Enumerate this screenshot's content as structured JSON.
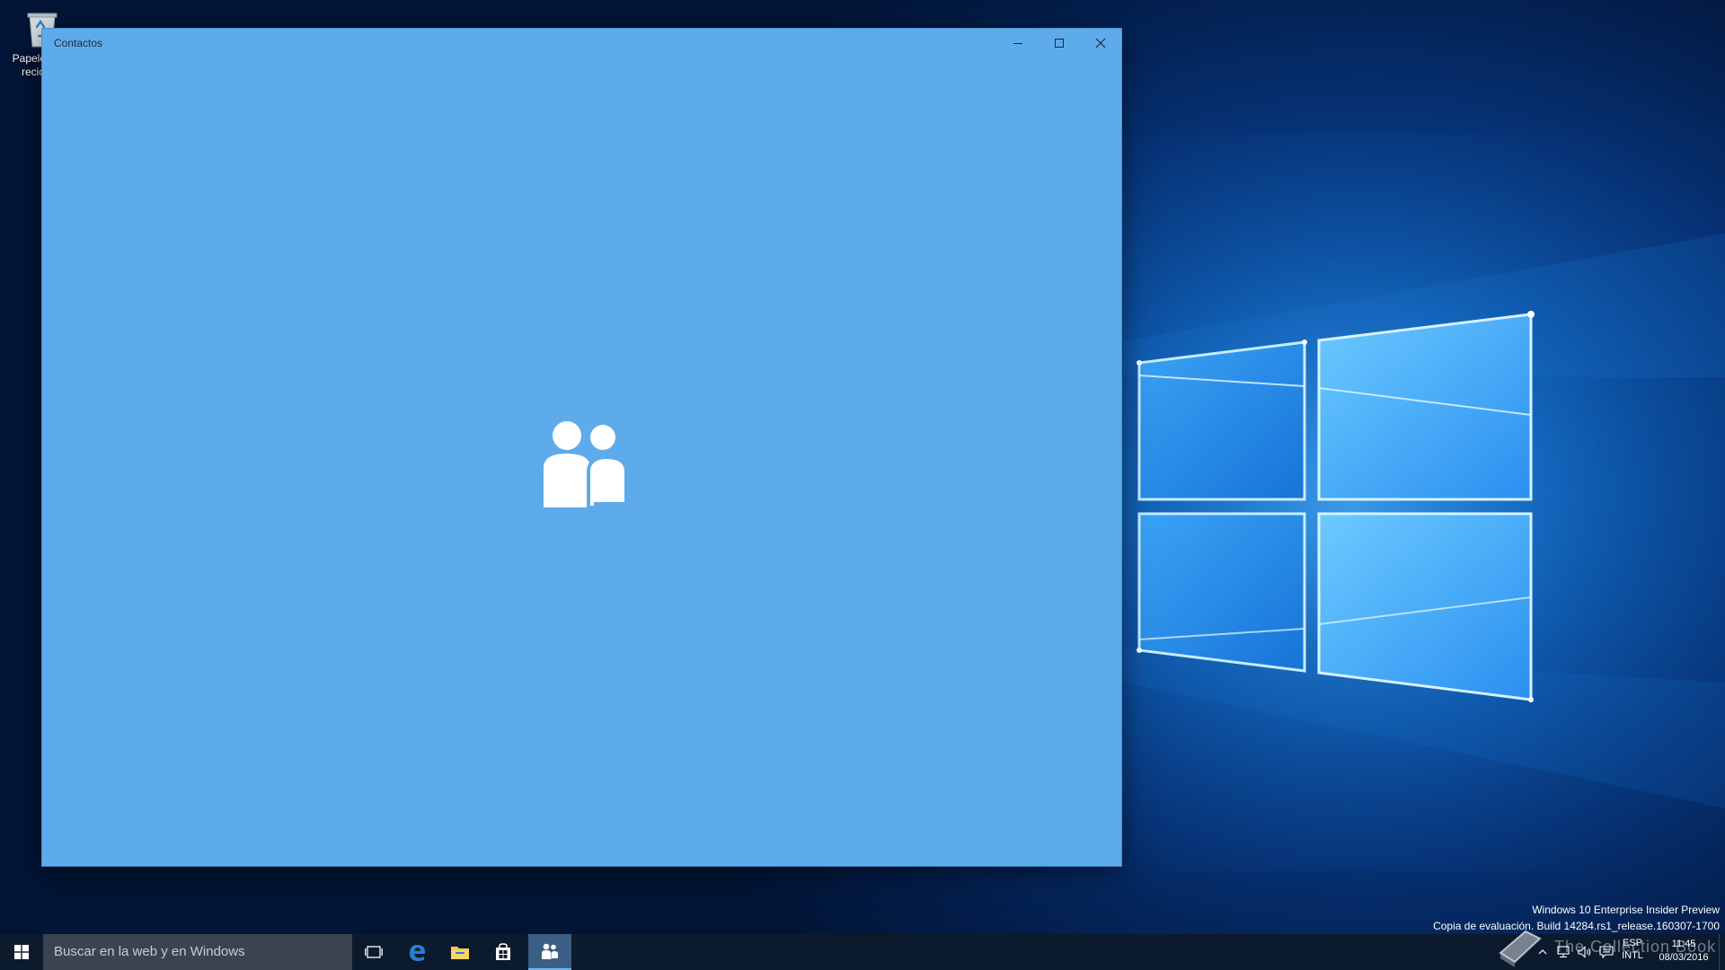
{
  "desktop": {
    "icons": [
      {
        "label": "Papelera de reciclaje",
        "icon": "recycle-bin-icon"
      }
    ]
  },
  "window": {
    "title": "Contactos",
    "background": "#5eabeb",
    "controls": {
      "minimize_icon": "minimize-icon",
      "maximize_icon": "maximize-icon",
      "close_icon": "close-icon"
    },
    "splash_icon": "people-icon"
  },
  "watermark": {
    "line1": "Windows 10 Enterprise Insider Preview",
    "line2": "Copia de evaluación. Build 14284.rs1_release.160307-1700"
  },
  "taskbar": {
    "search_placeholder": "Buscar en la web y en Windows",
    "apps": [
      {
        "name": "Vista de tareas",
        "icon": "task-view-icon"
      },
      {
        "name": "Microsoft Edge",
        "icon": "edge-icon",
        "color": "#2a7fd4"
      },
      {
        "name": "Explorador de archivos",
        "icon": "folder-icon",
        "color": "#f2c94c"
      },
      {
        "name": "Tienda",
        "icon": "store-icon"
      },
      {
        "name": "Contactos",
        "icon": "people-icon",
        "active": true
      }
    ],
    "tray": {
      "watermark_text": "The Collection Book",
      "language_line1": "ESP",
      "language_line2": "INTL",
      "time": "11:45",
      "date": "08/03/2016"
    }
  }
}
